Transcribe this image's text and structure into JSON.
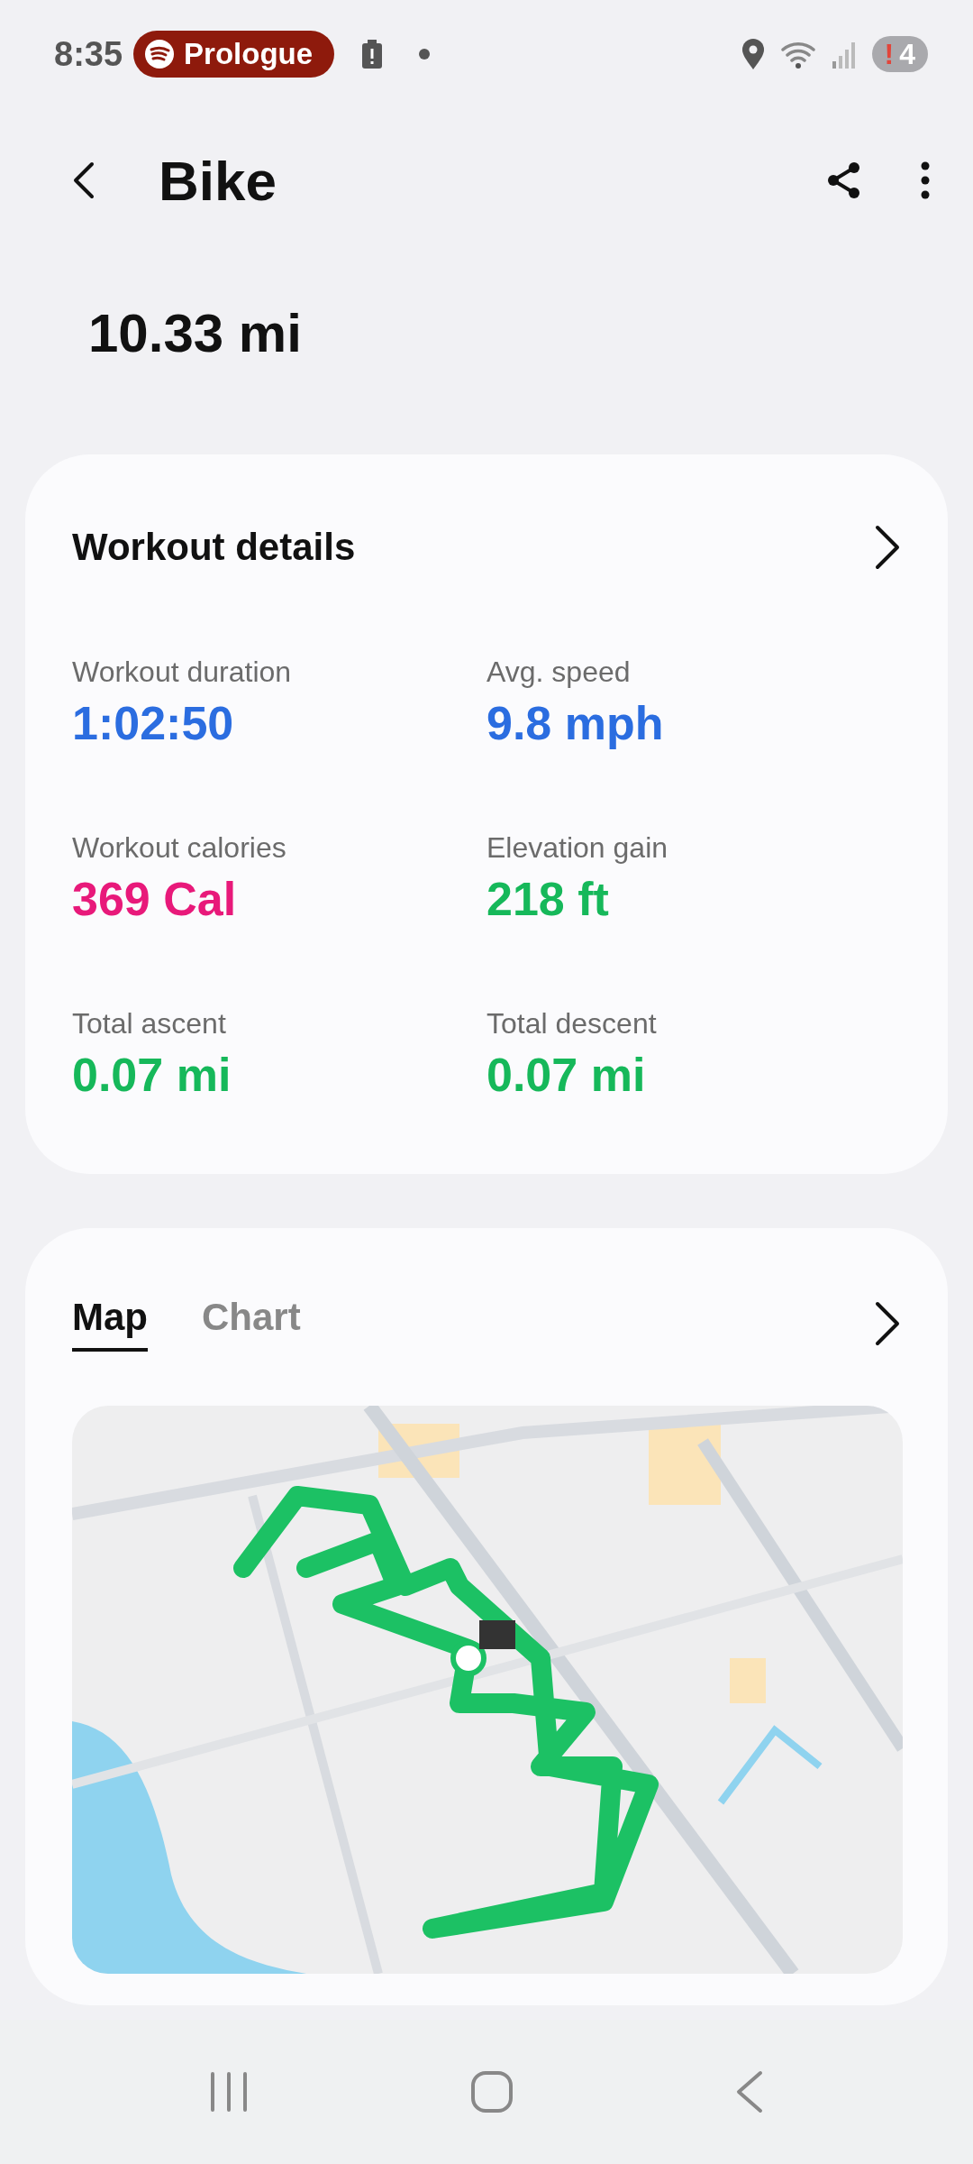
{
  "status_bar": {
    "time": "8:35",
    "media_chip": "Prologue",
    "alert_mark": "!",
    "notification_count": "4"
  },
  "header": {
    "title": "Bike"
  },
  "distance": "10.33 mi",
  "workout_details": {
    "title": "Workout details",
    "metrics": [
      {
        "label": "Workout duration",
        "value": "1:02:50",
        "color": "#2b6de0"
      },
      {
        "label": "Avg. speed",
        "value": "9.8 mph",
        "color": "#2b6de0"
      },
      {
        "label": "Workout calories",
        "value": "369 Cal",
        "color": "#e8197a"
      },
      {
        "label": "Elevation gain",
        "value": "218 ft",
        "color": "#16b85a"
      },
      {
        "label": "Total ascent",
        "value": "0.07 mi",
        "color": "#16b85a"
      },
      {
        "label": "Total descent",
        "value": "0.07 mi",
        "color": "#16b85a"
      }
    ]
  },
  "route": {
    "tabs": [
      {
        "label": "Map",
        "selected": true
      },
      {
        "label": "Chart",
        "selected": false
      }
    ]
  }
}
